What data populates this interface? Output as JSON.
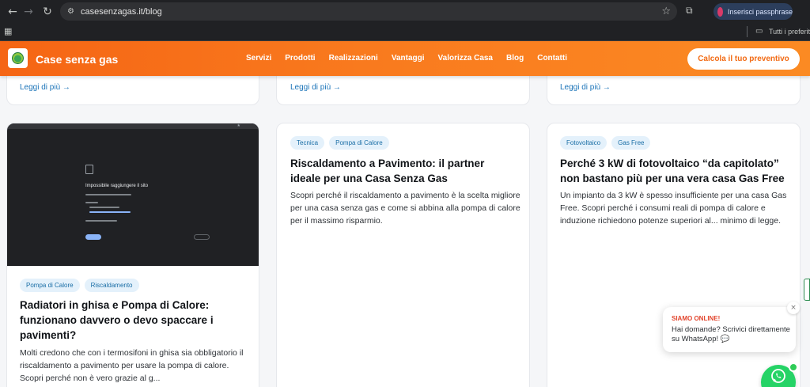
{
  "browser": {
    "url": "casesenzagas.it/blog",
    "passphrase_label": "Inserisci passphrase",
    "bookmarks_label": "Tutti i preferiti"
  },
  "site": {
    "brand": "Case senza gas",
    "menu": [
      "Servizi",
      "Prodotti",
      "Realizzazioni",
      "Vantaggi",
      "Valorizza Casa",
      "Blog",
      "Contatti"
    ],
    "cta": "Calcola il tuo preventivo"
  },
  "top_cards": [
    {
      "read_more": "Leggi di più →"
    },
    {
      "read_more": "Leggi di più →"
    },
    {
      "read_more": "Leggi di più →"
    }
  ],
  "cards": [
    {
      "tags": [
        "Pompa di Calore",
        "Riscaldamento"
      ],
      "title": "Radiatori in ghisa e Pompa di Calore: funzionano davvero o devo spaccare i pavimenti?",
      "text": "Molti credono che con i termosifoni in ghisa sia obbligatorio il riscaldamento a pavimento per usare la pompa di calore. Scopri perché non è vero grazie al g...",
      "thumbnail": {
        "heading": "Impossibile raggiungere il sito"
      }
    },
    {
      "tags": [
        "Tecnica",
        "Pompa di Calore"
      ],
      "title": "Riscaldamento a Pavimento: il partner ideale per una Casa Senza Gas",
      "text": "Scopri perché il riscaldamento a pavimento è la scelta migliore per una casa senza gas e come si abbina alla pompa di calore per il massimo risparmio."
    },
    {
      "tags": [
        "Fotovoltaico",
        "Gas Free"
      ],
      "title": "Perché 3 kW di fotovoltaico “da capitolato” non bastano più per una vera casa Gas Free",
      "text": "Un impianto da 3 kW è spesso insufficiente per una casa Gas Free. Scopri perché i consumi reali di pompa di calore e induzione richiedono potenze superiori al... minimo di legge."
    }
  ],
  "chat": {
    "status": "SIAMO ONLINE!",
    "message": "Hai domande? Scrivici direttamente su WhatsApp! 💬",
    "close": "×"
  },
  "colors": {
    "accent_orange": "#f97a1e",
    "link_blue": "#1a73b8",
    "whatsapp_green": "#25d366"
  }
}
